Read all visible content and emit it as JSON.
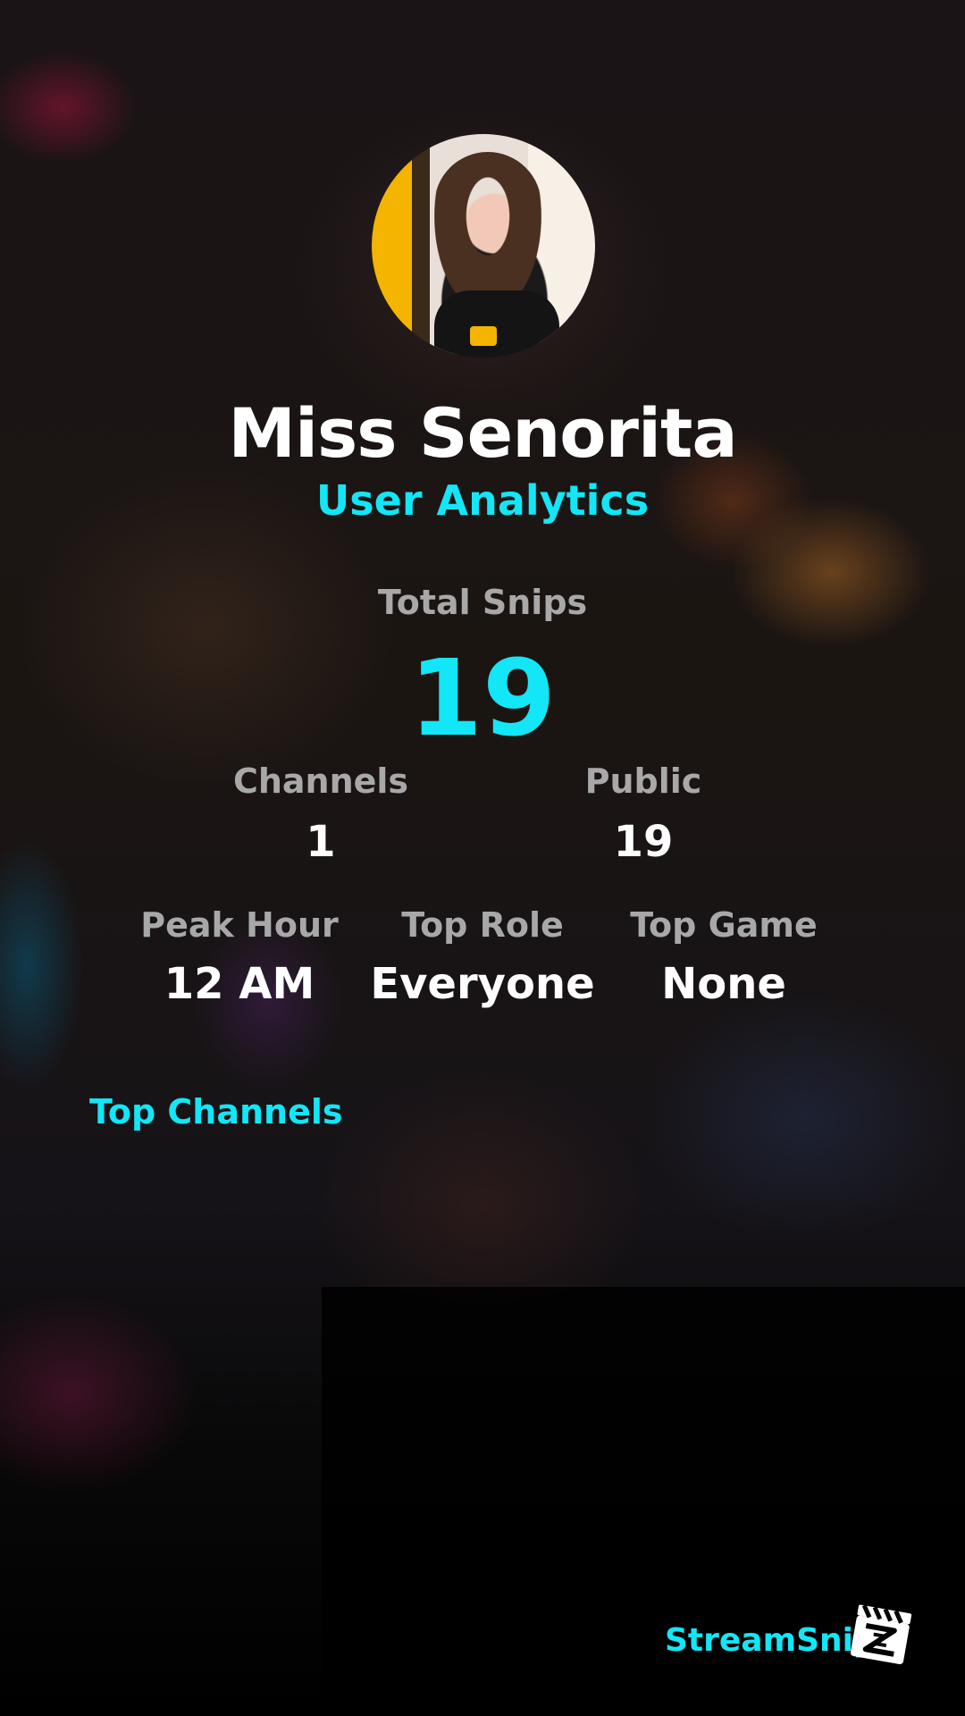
{
  "profile": {
    "name": "Miss Senorita",
    "subtitle": "User Analytics"
  },
  "summary": {
    "total_label": "Total Snips",
    "total_value": "19"
  },
  "stats_row1": [
    {
      "label": "Channels",
      "value": "1"
    },
    {
      "label": "Public",
      "value": "19"
    }
  ],
  "stats_row2": [
    {
      "label": "Peak Hour",
      "value": "12 AM"
    },
    {
      "label": "Top Role",
      "value": "Everyone"
    },
    {
      "label": "Top Game",
      "value": "None"
    }
  ],
  "sections": {
    "top_channels_title": "Top Channels"
  },
  "brand": {
    "name": "StreamSnip",
    "logo_icon": "clapperboard-icon"
  },
  "colors": {
    "accent": "#12e6f7",
    "label": "#a8a8a8",
    "text": "#ffffff"
  }
}
